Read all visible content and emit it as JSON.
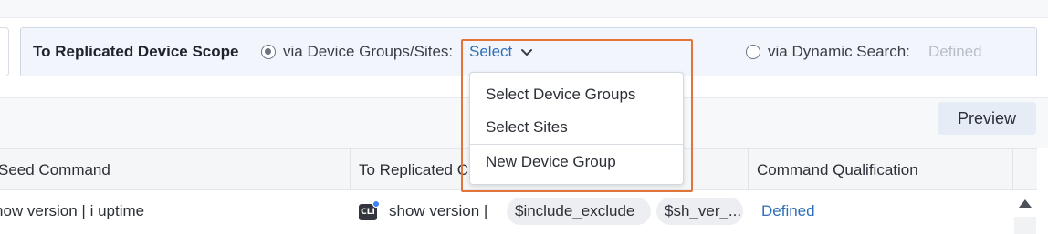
{
  "scope": {
    "title": "To Replicated Device Scope",
    "option_groups_label": "via Device Groups/Sites:",
    "option_groups_selected": true,
    "select_link": "Select",
    "option_dynamic_label": "via Dynamic Search:",
    "option_dynamic_selected": false,
    "dynamic_value": "Defined"
  },
  "dropdown": {
    "items": [
      "Select Device Groups",
      "Select Sites",
      "New Device Group"
    ]
  },
  "toolbar": {
    "preview_label": "Preview"
  },
  "table": {
    "columns": [
      "Seed Command",
      "To Replicated C",
      "Command Qualification"
    ],
    "rows": [
      {
        "seed_command": "how version | i uptime",
        "cli_badge": "CLI",
        "replicated_command": "show version |",
        "variables": [
          "$include_exclude",
          "$sh_ver_..."
        ],
        "qualification": "Defined"
      }
    ]
  },
  "colors": {
    "accent_link": "#2f6fb5",
    "focus_outline": "#e2743a",
    "scope_panel_bg": "#f2f6fc",
    "preview_bg": "#e6ecf5"
  }
}
